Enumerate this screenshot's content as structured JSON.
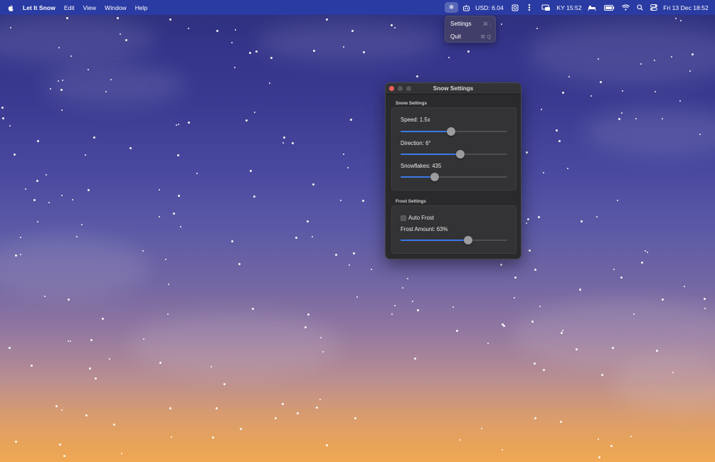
{
  "menubar": {
    "apple_icon": "apple-logo-icon",
    "app_name": "Let It Snow",
    "menus": [
      "Edit",
      "View",
      "Window",
      "Help"
    ],
    "status": {
      "snow_icon": "❄",
      "robot_icon": "robot-icon",
      "usd": "USD: 6.04",
      "camera_icon": "camera-frame-icon",
      "dots_icon": "vertical-dots-icon",
      "car_icon": "car-display-icon",
      "clock": "KY 15:52",
      "bed_icon": "bed-icon",
      "battery_icon": "battery-icon",
      "wifi_icon": "wifi-icon",
      "search_icon": "spotlight-search-icon",
      "control_center_icon": "control-center-icon",
      "datetime": "Fri 13 Dec  18:52"
    }
  },
  "dropdown": {
    "items": [
      {
        "label": "Settings",
        "shortcut": "⌘ ,"
      },
      {
        "label": "Quit",
        "shortcut": "⌘ Q"
      }
    ]
  },
  "window": {
    "title": "Snow Settings",
    "snow_section": {
      "label": "Snow Settings",
      "speed": {
        "label": "Speed: 1.5x",
        "fraction": 0.47
      },
      "direction": {
        "label": "Direction: 6°",
        "fraction": 0.56
      },
      "snowflakes": {
        "label": "Snowflakes: 435",
        "fraction": 0.32
      }
    },
    "frost_section": {
      "label": "Frost Settings",
      "auto_frost": {
        "label": "Auto Frost",
        "checked": false
      },
      "frost_amount": {
        "label": "Frost Amount: 63%",
        "fraction": 0.63
      }
    }
  },
  "colors": {
    "menubar": "#2a3ba3",
    "accent": "#3c78e6",
    "window_bg": "#2a2a2c",
    "close": "#ff5f57"
  }
}
